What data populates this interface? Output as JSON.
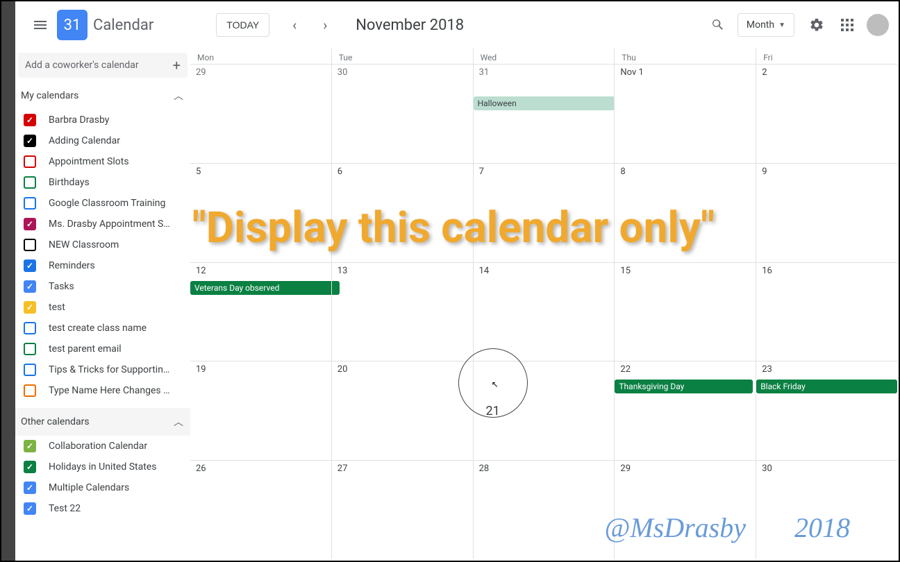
{
  "header": {
    "logo_day": "31",
    "app_title": "Calendar",
    "today_label": "TODAY",
    "month_title": "November 2018",
    "view_label": "Month"
  },
  "sidebar": {
    "add_coworker_placeholder": "Add a coworker's calendar",
    "my_calendars_label": "My calendars",
    "other_calendars_label": "Other calendars",
    "my_calendars": [
      {
        "label": "Barbra Drasby",
        "color": "#d50000",
        "checked": true
      },
      {
        "label": "Adding Calendar",
        "color": "#000000",
        "checked": true
      },
      {
        "label": "Appointment Slots",
        "color": "#d50000",
        "checked": false
      },
      {
        "label": "Birthdays",
        "color": "#0b8043",
        "checked": false
      },
      {
        "label": "Google Classroom Training",
        "color": "#1a73e8",
        "checked": false
      },
      {
        "label": "Ms. Drasby Appointment S…",
        "color": "#ad1457",
        "checked": true
      },
      {
        "label": "NEW Classroom",
        "color": "#000000",
        "checked": false
      },
      {
        "label": "Reminders",
        "color": "#1a73e8",
        "checked": true
      },
      {
        "label": "Tasks",
        "color": "#4285f4",
        "checked": true
      },
      {
        "label": "test",
        "color": "#f6bf26",
        "checked": true
      },
      {
        "label": "test create class name",
        "color": "#1a73e8",
        "checked": false
      },
      {
        "label": "test parent email",
        "color": "#0b8043",
        "checked": false
      },
      {
        "label": "Tips & Tricks for Supportin…",
        "color": "#1a73e8",
        "checked": false
      },
      {
        "label": "Type Name Here Changes …",
        "color": "#ef6c00",
        "checked": false
      }
    ],
    "other_calendars": [
      {
        "label": "Collaboration Calendar",
        "color": "#7cb342",
        "checked": true
      },
      {
        "label": "Holidays in United States",
        "color": "#0b8043",
        "checked": true
      },
      {
        "label": "Multiple Calendars",
        "color": "#4285f4",
        "checked": true
      },
      {
        "label": "Test 22",
        "color": "#4285f4",
        "checked": true
      }
    ]
  },
  "calendar": {
    "weekdays": [
      "Mon",
      "Tue",
      "Wed",
      "Thu",
      "Fri"
    ],
    "weeks": [
      [
        {
          "n": "29",
          "muted": true
        },
        {
          "n": "30",
          "muted": true
        },
        {
          "n": "31",
          "muted": true
        },
        {
          "n": "Nov 1"
        },
        {
          "n": "2"
        }
      ],
      [
        {
          "n": "5"
        },
        {
          "n": "6"
        },
        {
          "n": "7"
        },
        {
          "n": "8"
        },
        {
          "n": "9"
        }
      ],
      [
        {
          "n": "12"
        },
        {
          "n": "13"
        },
        {
          "n": "14"
        },
        {
          "n": "15"
        },
        {
          "n": "16"
        }
      ],
      [
        {
          "n": "19"
        },
        {
          "n": "20"
        },
        {
          "n": "21",
          "today": true
        },
        {
          "n": "22"
        },
        {
          "n": "23"
        }
      ],
      [
        {
          "n": "26"
        },
        {
          "n": "27"
        },
        {
          "n": "28"
        },
        {
          "n": "29"
        },
        {
          "n": "30"
        }
      ]
    ],
    "events": {
      "halloween": "Halloween",
      "veterans": "Veterans Day observed",
      "thanksgiving": "Thanksgiving Day",
      "black_friday": "Black Friday"
    }
  },
  "overlay": {
    "main_text": "\"Display this calendar only\"",
    "watermark_handle": "@MsDrasby",
    "watermark_year": "2018"
  }
}
